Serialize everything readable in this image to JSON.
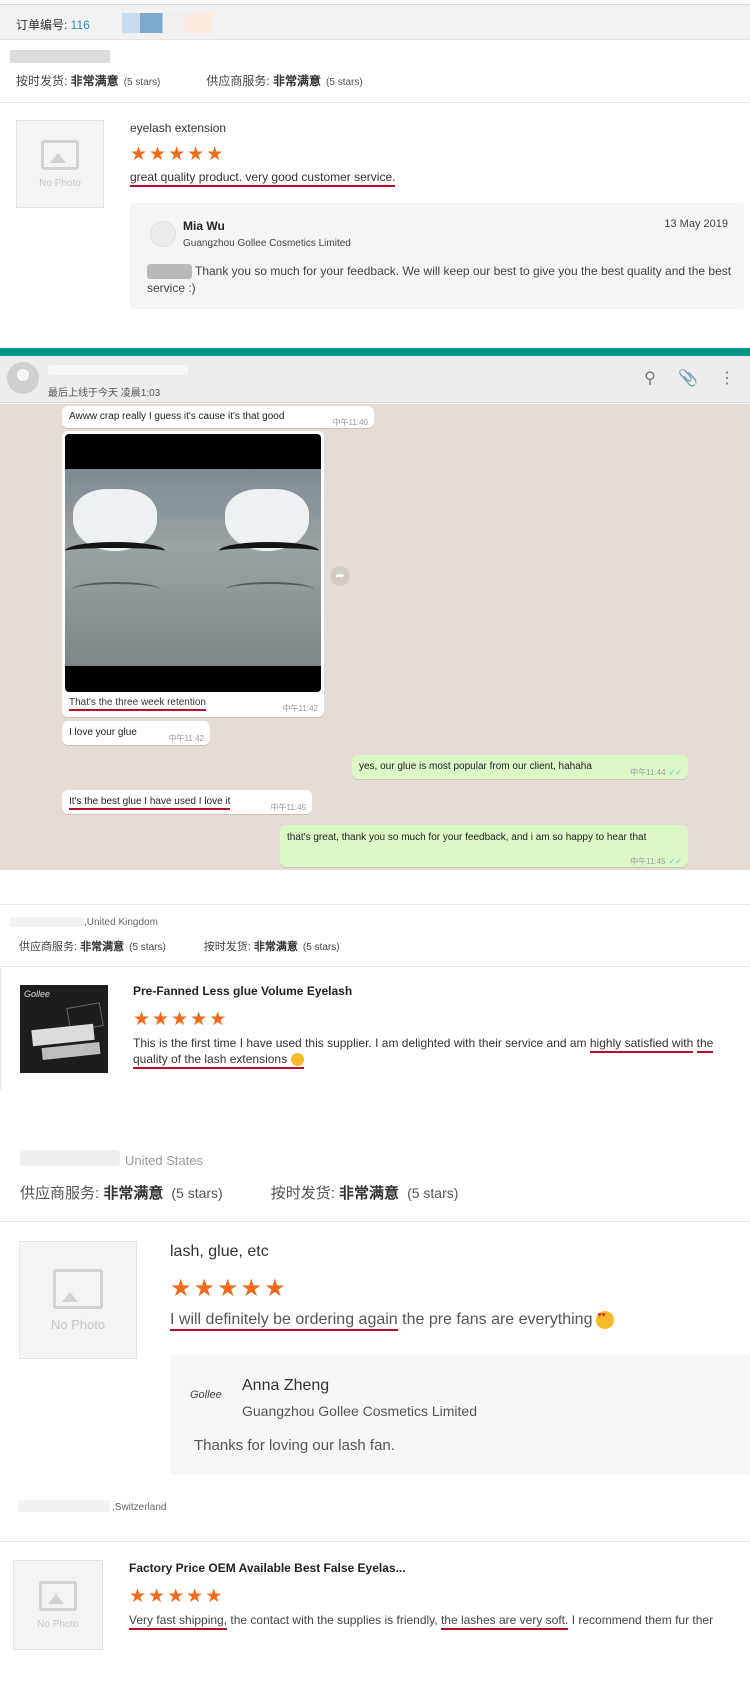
{
  "review1": {
    "order_label": "订单编号: ",
    "order_number": "116",
    "ship_label": "按时发货: ",
    "ship_value": "非常满意",
    "ship_stars": "(5 stars)",
    "service_label": "供应商服务: ",
    "service_value": "非常满意",
    "service_stars": "(5 stars)",
    "no_photo": "No Photo",
    "product": "eyelash extension",
    "rating": 5,
    "text": "great quality product. very good customer service.",
    "reply": {
      "name": "Mia Wu",
      "company": "Guangzhou Gollee Cosmetics Limited",
      "date": "13 May 2019",
      "message": "Thank you so much for your feedback. We will keep our best to give you the best quality and the best service :)"
    }
  },
  "chat": {
    "last_seen": "最后上线于今天 凌晨1:03",
    "icons": [
      "search-icon",
      "attach-icon",
      "menu-icon"
    ],
    "messages": [
      {
        "dir": "in",
        "text": "Awww crap really I guess it's cause it's that good",
        "time": "中午11:40"
      },
      {
        "dir": "in",
        "text": "That's the three week retention",
        "time": "中午11:42"
      },
      {
        "dir": "in",
        "text": "I love your glue",
        "time": "中午11:42"
      },
      {
        "dir": "out",
        "text": "yes, our glue is most popular from our client, hahaha",
        "time": "中午11:44"
      },
      {
        "dir": "in",
        "text": "It's the best glue I have used I love it",
        "time": "中午11:45"
      },
      {
        "dir": "out",
        "text": "that's great, thank you so much for your feedback, and i am so happy to hear that",
        "time": "中午11:45"
      }
    ]
  },
  "review2": {
    "location": ",United Kingdom",
    "service_label": "供应商服务: ",
    "service_value": "非常满意",
    "service_stars": "(5 stars)",
    "ship_label": "按时发货: ",
    "ship_value": "非常满意",
    "ship_stars": "(5 stars)",
    "brand": "Gollee",
    "product": "Pre-Fanned Less glue Volume Eyelash",
    "rating": 5,
    "text_a": "This is the first time I have used this supplier. I am delighted with their service and am ",
    "text_b": "highly satisfied with",
    "text_c": "the quality of the lash extensions"
  },
  "review3": {
    "location": "United States",
    "service_label": "供应商服务: ",
    "service_value": "非常满意",
    "service_stars": "(5 stars)",
    "ship_label": "按时发货: ",
    "ship_value": "非常满意",
    "ship_stars": "(5 stars)",
    "no_photo": "No Photo",
    "product": "lash, glue, etc",
    "rating": 5,
    "text_a": "I will definitely be ordering again",
    "text_b": " the pre fans are everything",
    "reply": {
      "logo": "Gollee",
      "name": "Anna Zheng",
      "company": "Guangzhou Gollee Cosmetics Limited",
      "message": "Thanks for loving our lash fan."
    }
  },
  "review4": {
    "location": ",Switzerland",
    "no_photo": "No Photo",
    "product": "Factory Price OEM Available Best False Eyelas...",
    "rating": 5,
    "text_a": "Very fast shipping,",
    "text_b": " the contact with the supplies is friendly, ",
    "text_c": "the lashes are very soft.",
    "text_d": " I recommend them fur ther"
  },
  "colors": {
    "star": "#f26b1d",
    "underline": "#b0102a",
    "teal": "#009688",
    "chat_bg": "#e5ddd5",
    "bubble_out": "#dcf8c6",
    "order_number": "#2b8fd0"
  }
}
